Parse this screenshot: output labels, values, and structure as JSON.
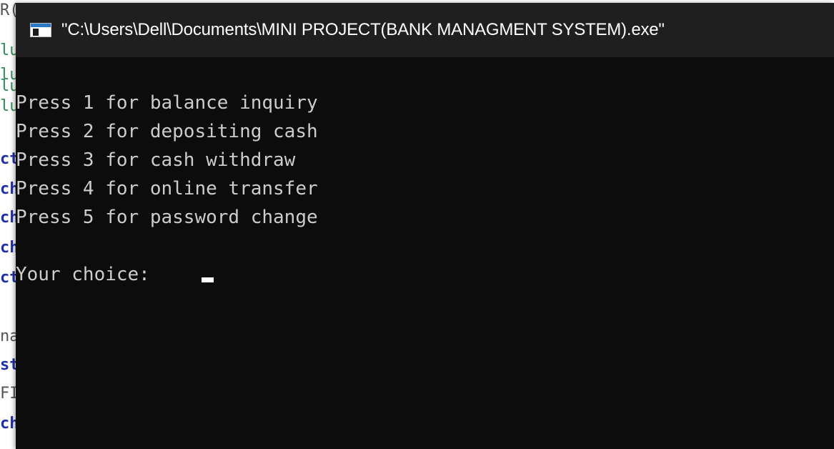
{
  "editor": {
    "lines": [
      {
        "text": "R(",
        "color": "gray"
      },
      {
        "text": "lu",
        "color": "green"
      },
      {
        "text": "lu",
        "color": "green"
      },
      {
        "text": "lu",
        "color": "green"
      },
      {
        "text": "lu",
        "color": "green"
      },
      {
        "text": "ct",
        "color": "blue"
      },
      {
        "text": "ch",
        "color": "blue"
      },
      {
        "text": "ch",
        "color": "blue"
      },
      {
        "text": "ch",
        "color": "blue"
      },
      {
        "text": "ct",
        "color": "blue"
      },
      {
        "text": "na",
        "color": "gray"
      },
      {
        "text": "st",
        "color": "blue"
      },
      {
        "text": "FI",
        "color": "gray"
      },
      {
        "text": "ch",
        "color": "blue"
      }
    ]
  },
  "window": {
    "title": "\"C:\\Users\\Dell\\Documents\\MINI PROJECT(BANK MANAGMENT SYSTEM).exe\"",
    "icon": "console-app-icon"
  },
  "console": {
    "menu_lines": [
      "Press 1 for balance inquiry",
      "Press 2 for depositing cash",
      "Press 3 for cash withdraw",
      "Press 4 for online transfer",
      "Press 5 for password change"
    ],
    "prompt": "Your choice:",
    "text_color": "#cccccc",
    "background": "#0c0c0c"
  }
}
